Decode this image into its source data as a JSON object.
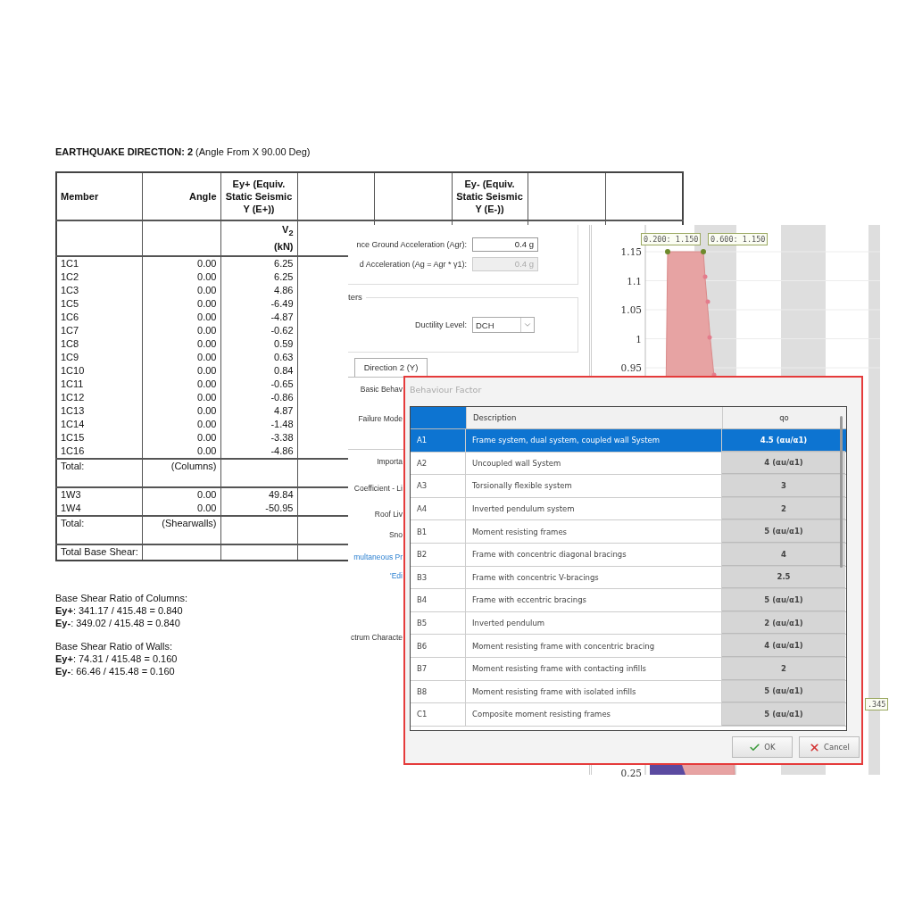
{
  "report": {
    "title": "**EARTHQUAKE DIRECTION: 2**  (Angle From X 90.00 Deg)",
    "columns": [
      {
        "label": "Member"
      },
      {
        "label": "Angle"
      },
      {
        "label": "Ey+ (Equiv. Static Seismic Y (E+))"
      },
      {},
      {},
      {
        "label": "Ey- (Equiv. Static Seismic Y (E-))"
      },
      {},
      {}
    ],
    "unit": {
      "symbol": "V$_{2}$",
      "unit": "(kN)"
    },
    "groups": [
      {
        "rows": [
          {
            "member": "1C1",
            "angle": "0.00",
            "v2": "6.25"
          },
          {
            "member": "1C2",
            "angle": "0.00",
            "v2": "6.25"
          },
          {
            "member": "1C3",
            "angle": "0.00",
            "v2": "4.86"
          },
          {
            "member": "1C5",
            "angle": "0.00",
            "v2": "-6.49"
          },
          {
            "member": "1C6",
            "angle": "0.00",
            "v2": "-4.87"
          },
          {
            "member": "1C7",
            "angle": "0.00",
            "v2": "-0.62"
          },
          {
            "member": "1C8",
            "angle": "0.00",
            "v2": "0.59"
          },
          {
            "member": "1C9",
            "angle": "0.00",
            "v2": "0.63"
          },
          {
            "member": "1C10",
            "angle": "0.00",
            "v2": "0.84"
          },
          {
            "member": "1C11",
            "angle": "0.00",
            "v2": "-0.65"
          },
          {
            "member": "1C12",
            "angle": "0.00",
            "v2": "-0.86"
          },
          {
            "member": "1C13",
            "angle": "0.00",
            "v2": "4.87"
          },
          {
            "member": "1C14",
            "angle": "0.00",
            "v2": "-1.48"
          },
          {
            "member": "1C15",
            "angle": "0.00",
            "v2": "-3.38"
          },
          {
            "member": "1C16",
            "angle": "0.00",
            "v2": "-4.86"
          }
        ],
        "total": {
          "label": "Total:",
          "note": "(Columns)"
        }
      },
      {
        "rows": [
          {
            "member": "1W3",
            "angle": "0.00",
            "v2": "49.84"
          },
          {
            "member": "1W4",
            "angle": "0.00",
            "v2": "-50.95"
          }
        ],
        "total": {
          "label": "Total:",
          "note": "(Shearwalls)"
        }
      }
    ],
    "base_shear": "Total Base Shear:",
    "ratios": [
      {
        "title": "Base Shear Ratio of Columns:",
        "lines": [
          "**Ey+**: 341.17 / 415.48 = 0.840",
          "**Ey-**: 349.02 / 415.48 = 0.840"
        ]
      },
      {
        "title": "Base Shear Ratio of Walls:",
        "lines": [
          "**Ey+**: 74.31 / 415.48 = 0.160",
          "**Ey-**: 66.46 / 415.48 = 0.160"
        ]
      }
    ]
  },
  "settings": {
    "fields": [
      {
        "label": "nce Ground Acceleration (Agr):",
        "value": "0.4 g",
        "disabled": false
      },
      {
        "label": "d Acceleration (Ag = Agr * γ1):",
        "value": "0.4 g",
        "disabled": true
      }
    ],
    "group_label": "ters",
    "ductility": {
      "label": "Ductility Level:",
      "value": "DCH"
    },
    "tab": "Direction 2 (Y)",
    "labels": [
      {
        "kind": "label",
        "text": "Basic Behav"
      },
      {
        "kind": "label",
        "text": "Failure Mode"
      },
      {
        "kind": "rule"
      },
      {
        "kind": "label",
        "text": "Importa"
      },
      {
        "kind": "label",
        "text": "Coefficient - Li"
      },
      {
        "kind": "label",
        "text": "Roof Liv"
      },
      {
        "kind": "label",
        "text": "Sno"
      },
      {
        "kind": "link",
        "text": "multaneous Pr"
      },
      {
        "kind": "link",
        "text": "'Edi"
      },
      {
        "kind": "label",
        "text": "ctrum Characte"
      }
    ]
  },
  "chart": {
    "yticks": [
      "1.15",
      "1.1",
      "1.05",
      "1",
      "0.95",
      "0.25"
    ],
    "point_labels": [
      "0.200: 1.150",
      "0.600: 1.150",
      ".345"
    ]
  },
  "dialog": {
    "title": "Behaviour Factor",
    "columns": [
      "Description",
      "qo"
    ],
    "rows": [
      {
        "code": "A1",
        "description": "Frame system, dual system, coupled wall System",
        "qo": "4.5 (αu/α1)",
        "selected": true
      },
      {
        "code": "A2",
        "description": "Uncoupled wall System",
        "qo": "4 (αu/α1)",
        "selected": false
      },
      {
        "code": "A3",
        "description": "Torsionally flexible system",
        "qo": "3",
        "selected": false
      },
      {
        "code": "A4",
        "description": "Inverted pendulum system",
        "qo": "2",
        "selected": false
      },
      {
        "code": "B1",
        "description": "Moment resisting frames",
        "qo": "5 (αu/α1)",
        "selected": false
      },
      {
        "code": "B2",
        "description": "Frame with concentric diagonal bracings",
        "qo": "4",
        "selected": false
      },
      {
        "code": "B3",
        "description": "Frame with concentric V-bracings",
        "qo": "2.5",
        "selected": false
      },
      {
        "code": "B4",
        "description": "Frame with eccentric bracings",
        "qo": "5 (αu/α1)",
        "selected": false
      },
      {
        "code": "B5",
        "description": "Inverted pendulum",
        "qo": "2 (αu/α1)",
        "selected": false
      },
      {
        "code": "B6",
        "description": "Moment resisting frame with concentric bracing",
        "qo": "4 (αu/α1)",
        "selected": false
      },
      {
        "code": "B7",
        "description": "Moment resisting frame with contacting infills",
        "qo": "2",
        "selected": false
      },
      {
        "code": "B8",
        "description": "Moment resisting frame with isolated infills",
        "qo": "5 (αu/α1)",
        "selected": false
      },
      {
        "code": "C1",
        "description": "Composite moment resisting frames",
        "qo": "5 (αu/α1)",
        "selected": false
      }
    ],
    "buttons": [
      {
        "kind": "ok",
        "label": "OK"
      },
      {
        "kind": "cancel",
        "label": "Cancel"
      }
    ]
  }
}
